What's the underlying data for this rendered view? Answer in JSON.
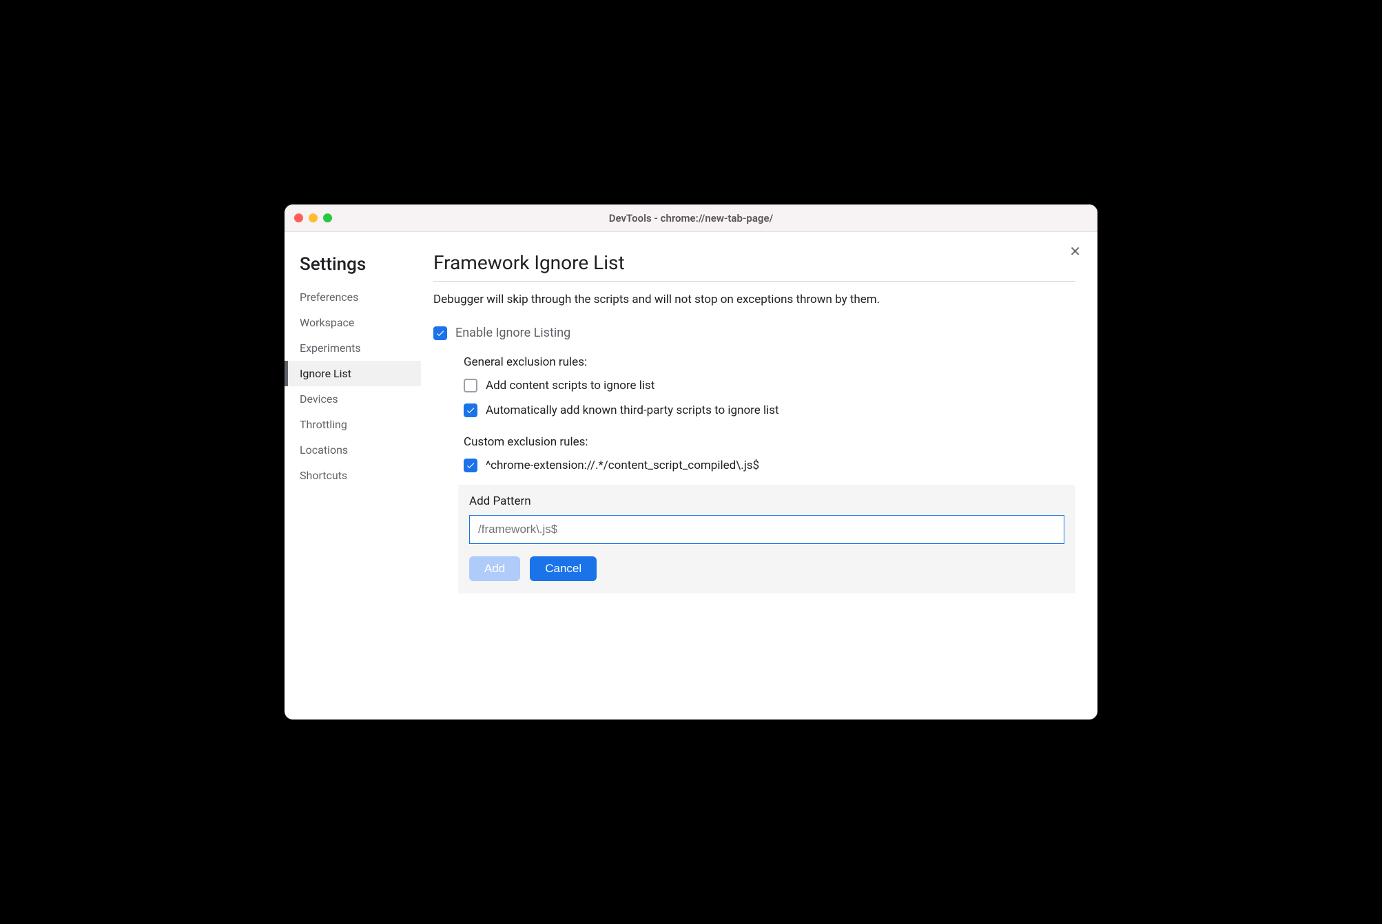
{
  "window": {
    "title": "DevTools - chrome://new-tab-page/"
  },
  "sidebar": {
    "heading": "Settings",
    "items": [
      {
        "label": "Preferences",
        "active": false
      },
      {
        "label": "Workspace",
        "active": false
      },
      {
        "label": "Experiments",
        "active": false
      },
      {
        "label": "Ignore List",
        "active": true
      },
      {
        "label": "Devices",
        "active": false
      },
      {
        "label": "Throttling",
        "active": false
      },
      {
        "label": "Locations",
        "active": false
      },
      {
        "label": "Shortcuts",
        "active": false
      }
    ]
  },
  "main": {
    "title": "Framework Ignore List",
    "description": "Debugger will skip through the scripts and will not stop on exceptions thrown by them.",
    "enable_label": "Enable Ignore Listing",
    "enable_checked": true,
    "general_section": "General exclusion rules:",
    "general_rules": [
      {
        "label": "Add content scripts to ignore list",
        "checked": false
      },
      {
        "label": "Automatically add known third-party scripts to ignore list",
        "checked": true
      }
    ],
    "custom_section": "Custom exclusion rules:",
    "custom_rules": [
      {
        "label": "^chrome-extension://.*/content_script_compiled\\.js$",
        "checked": true
      }
    ],
    "add_pattern": {
      "heading": "Add Pattern",
      "placeholder": "/framework\\.js$",
      "add_button": "Add",
      "cancel_button": "Cancel"
    }
  }
}
